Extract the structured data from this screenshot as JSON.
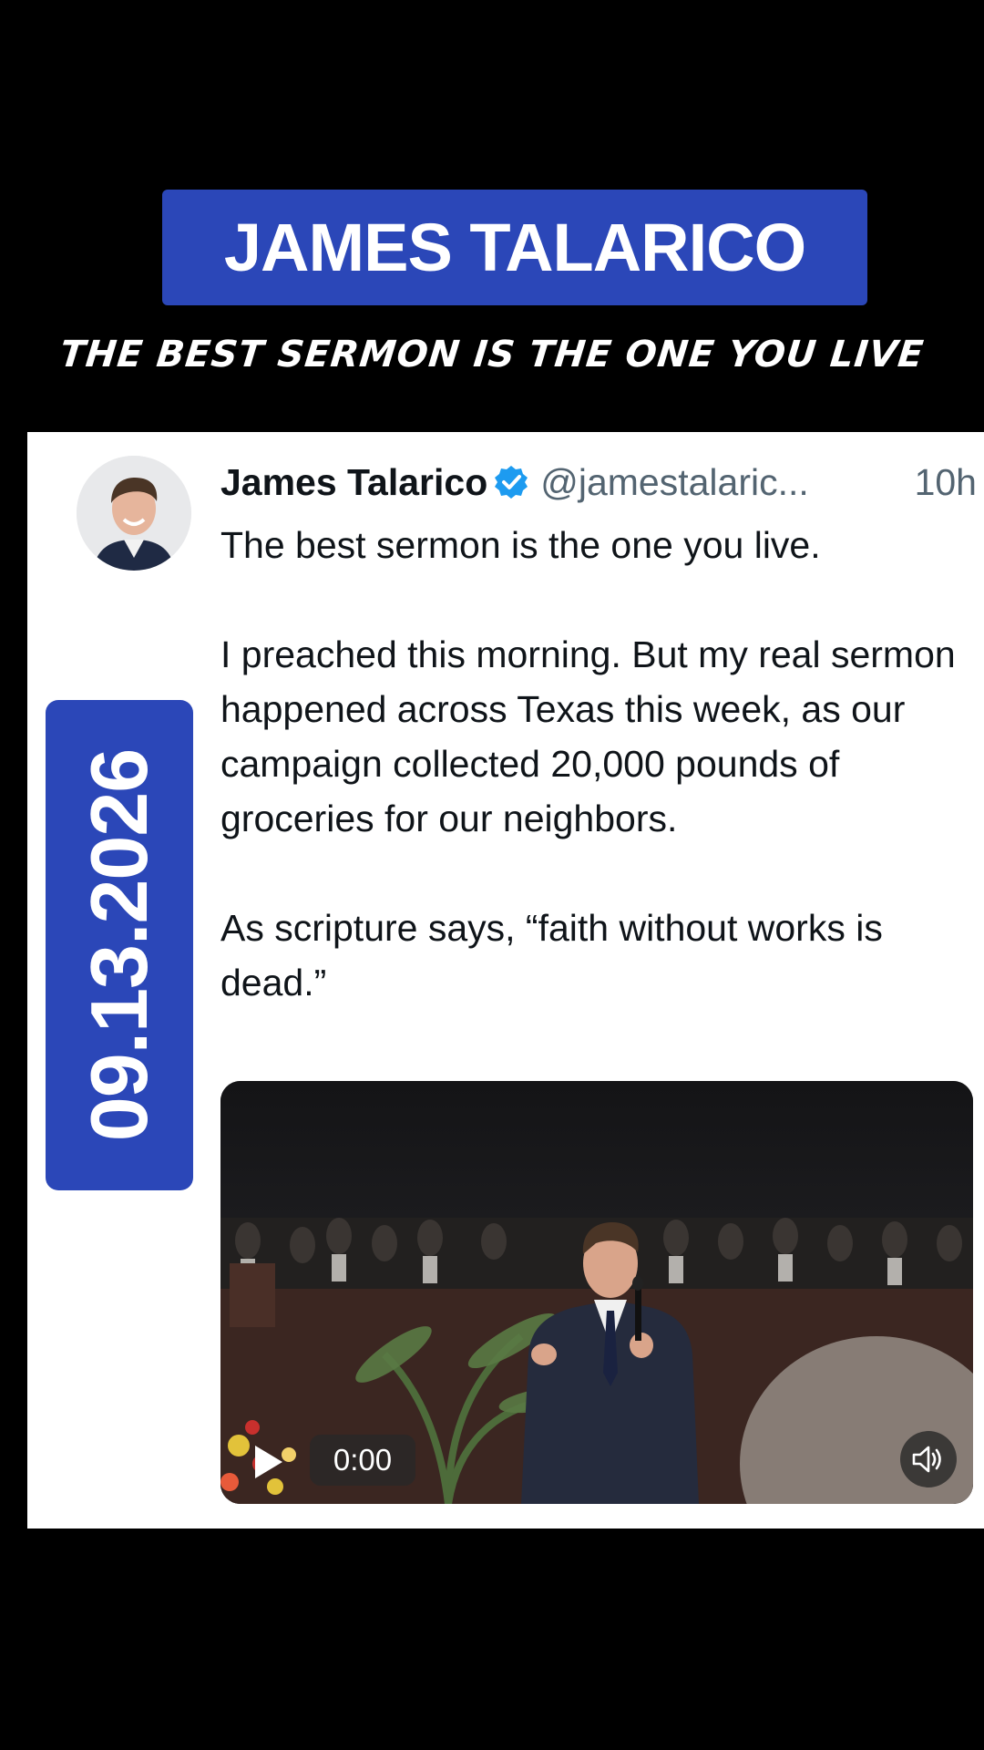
{
  "header": {
    "title": "JAMES TALARICO",
    "subtitle": "THE BEST SERMON IS THE ONE YOU LIVE"
  },
  "date_badge": "09.13.2026",
  "tweet": {
    "name": "James Talarico",
    "verified_icon": "verified-badge-icon",
    "handle": "@jamestalaric...",
    "time": "10h",
    "paragraphs": [
      "The best sermon is the one you live.",
      "I preached this morning. But my real sermon happened across Texas this week, as our campaign collected 20,000 pounds of groceries for our neighbors.",
      "As scripture says, “faith without works is dead.”"
    ]
  },
  "video": {
    "time": "0:00",
    "play_icon": "play-icon",
    "volume_icon": "volume-icon"
  },
  "colors": {
    "banner": "#2b47b8",
    "verified": "#1d9bf0",
    "text": "#0f1419",
    "muted": "#536471"
  }
}
